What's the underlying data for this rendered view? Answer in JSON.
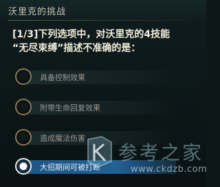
{
  "header": {
    "title": "沃里克的挑战"
  },
  "question": {
    "line1": "[1/3]下列选项中，对沃里克的4技能",
    "line2": "“无尽束缚”描述不准确的是："
  },
  "options": [
    {
      "label": "具备控制效果",
      "selected": false
    },
    {
      "label": "附带生命回复效果",
      "selected": false
    },
    {
      "label": "造成魔法伤害",
      "selected": false
    },
    {
      "label": "大招期间可被打断",
      "selected": true
    }
  ],
  "watermark": {
    "text": "参考之家",
    "url": "www.ckdzb.com"
  },
  "colors": {
    "accent_gold": "#8a7b55",
    "selected_blue": "#2a6fa8"
  }
}
